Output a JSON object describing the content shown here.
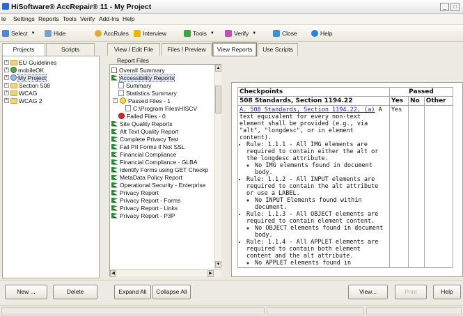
{
  "window": {
    "title": "HiSoftware® AccRepair® 11 - My Project",
    "min_glyph": "_",
    "max_glyph": "□"
  },
  "menu": {
    "items": [
      "le",
      "Settings",
      "Reports",
      "Tools",
      "Verify",
      "Add-Ins",
      "Help"
    ]
  },
  "toolbar": {
    "select": "Select",
    "hide": "Hide",
    "accrules": "AccRules",
    "interview": "Interview",
    "tools": "Tools",
    "verify": "Verify",
    "close": "Close",
    "help": "Help",
    "dropdown_glyph": "▼"
  },
  "left_tabs": {
    "projects": "Projects",
    "scripts": "Scripts"
  },
  "projects_tree": [
    {
      "label": "EU Guidelines",
      "icon": "folder-icon"
    },
    {
      "label": "mobileOK",
      "icon": "globe-icon"
    },
    {
      "label": "My Project",
      "icon": "globe-icon",
      "selected": true
    },
    {
      "label": "Section 508",
      "icon": "folder-icon"
    },
    {
      "label": "WCAG",
      "icon": "folder-icon"
    },
    {
      "label": "WCAG 2",
      "icon": "folder-icon"
    }
  ],
  "view_tabs": {
    "view_edit": "View / Edit File",
    "files_preview": "Files / Preview",
    "view_reports": "View Reports",
    "use_scripts": "Use Scripts"
  },
  "report_files": {
    "label": "Report Files",
    "items": [
      {
        "label": "Overall Summary",
        "icon": "checkbox-icon"
      },
      {
        "label": "Accessibility Reports",
        "icon": "flag-icon",
        "selected": true
      },
      {
        "label": "Summary",
        "icon": "document-icon"
      },
      {
        "label": "Statistics Summary",
        "icon": "document-icon"
      },
      {
        "label": "Passed Files - 1",
        "icon": "smiley-icon"
      },
      {
        "label": "C:\\Program Files\\HISCV",
        "icon": "document-icon"
      },
      {
        "label": "Failed Files - 0",
        "icon": "red-ball-icon"
      },
      {
        "label": "Site Quality Reports",
        "icon": "flag-icon"
      },
      {
        "label": "Alt Text Quality Report",
        "icon": "flag-icon"
      },
      {
        "label": "Complete Privacy Test",
        "icon": "flag-icon"
      },
      {
        "label": "Fail PII Forms if Not SSL",
        "icon": "flag-icon"
      },
      {
        "label": "Financial Compliance",
        "icon": "flag-icon"
      },
      {
        "label": "Financial Compliance - GLBA",
        "icon": "flag-icon"
      },
      {
        "label": "Identify Forms using GET Checkp",
        "icon": "flag-icon"
      },
      {
        "label": "MetaData Policy Report",
        "icon": "flag-icon"
      },
      {
        "label": "Operational Security - Enterprise",
        "icon": "flag-icon"
      },
      {
        "label": "Privacy Report",
        "icon": "flag-icon"
      },
      {
        "label": "Privacy Report - Forms",
        "icon": "flag-icon"
      },
      {
        "label": "Privacy Report - Links",
        "icon": "flag-icon"
      },
      {
        "label": "Privacy Report - P3P",
        "icon": "flag-icon"
      }
    ]
  },
  "report": {
    "col_checkpoints": "Checkpoints",
    "col_passed": "Passed",
    "section": "508 Standards, Section 1194.22",
    "col_yes": "Yes",
    "col_no": "No",
    "col_other": "Other",
    "link": "A. 508 Standards, Section 1194.22, (a)",
    "desc": " A text equivalent for every non-text element shall be provided (e.g., via \"alt\", \"longdesc\", or in element content).",
    "yes_value": "Yes",
    "rules": [
      {
        "text": "Rule: 1.1.1 - All IMG elements are required to contain either the alt or the longdesc attribute.",
        "result": "No IMG elements found in document body."
      },
      {
        "text": "Rule: 1.1.2 - All INPUT elements are required to contain the alt attribute or use a LABEL.",
        "result": "No INPUT Elements found within document."
      },
      {
        "text": "Rule: 1.1.3 - All OBJECT elements are required to contain element content.",
        "result": "No OBJECT elements found in document body."
      },
      {
        "text": "Rule: 1.1.4 - All APPLET elements are required to contain both element content and the alt attribute.",
        "result": "No APPLET elements found in"
      }
    ]
  },
  "buttons": {
    "new": "New ...",
    "delete": "Delete",
    "expand_all": "Expand All",
    "collapse_all": "Collapse All",
    "view": "View...",
    "print": "Print",
    "help": "Help"
  },
  "colors": {
    "accent_blue": "#2a6bd1",
    "link_blue": "#1f1fd1",
    "flag_green": "#2e8b37"
  }
}
